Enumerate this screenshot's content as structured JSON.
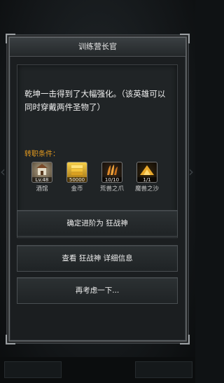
{
  "dialog": {
    "title": "训练营长官",
    "message": "乾坤一击得到了大幅强化。（该英雄可以同时穿戴两件圣物了）",
    "requirements_label": "转职条件：",
    "requirements": [
      {
        "name": "酒馆",
        "count": "Lv.48",
        "icon": "tavern-icon",
        "color": "#8a7a62"
      },
      {
        "name": "金币",
        "count": "50000",
        "icon": "gold-coin-icon",
        "color": "#d4a21c"
      },
      {
        "name": "荒兽之爪",
        "count": "10/10",
        "icon": "beast-claw-icon",
        "color": "#a15a1c"
      },
      {
        "name": "魔兽之沙",
        "count": "1/1",
        "icon": "demon-sand-icon",
        "color": "#c98a1a"
      }
    ],
    "buttons": {
      "confirm": "确定进阶为 狂战神",
      "details": "查看 狂战神 详细信息",
      "cancel": "再考虑一下..."
    }
  }
}
